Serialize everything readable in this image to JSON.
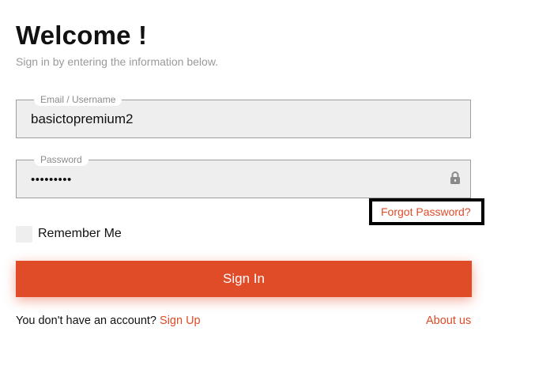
{
  "header": {
    "title": "Welcome !",
    "subtitle": "Sign in by entering the information below."
  },
  "form": {
    "username": {
      "label": "Email / Username",
      "value": "basictopremium2"
    },
    "password": {
      "label": "Password",
      "masked_value": "•••••••••",
      "icon": "lock-icon"
    },
    "forgot_password_label": "Forgot Password?",
    "remember_me_label": "Remember Me",
    "remember_me_checked": false,
    "sign_in_label": "Sign In"
  },
  "footer": {
    "no_account_text": "You don't have an account?",
    "sign_up_label": "Sign Up",
    "about_label": "About us"
  },
  "colors": {
    "accent": "#e04b28",
    "field_background": "#eeeeee",
    "highlight_border": "#000000"
  }
}
